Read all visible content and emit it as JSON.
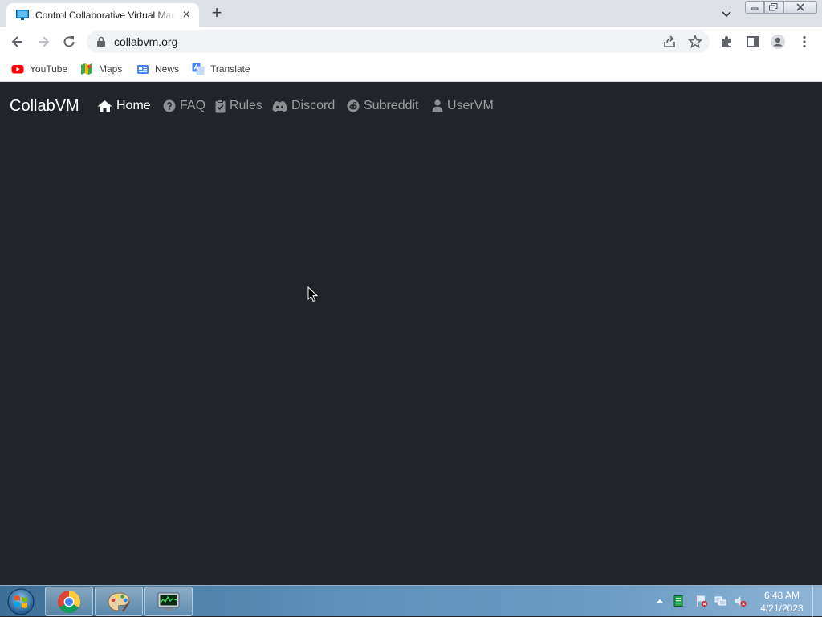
{
  "browser": {
    "tab": {
      "title": "Control Collaborative Virtual Machines!"
    },
    "address": {
      "url": "collabvm.org"
    },
    "bookmarks": [
      {
        "label": "YouTube",
        "icon": "youtube-icon"
      },
      {
        "label": "Maps",
        "icon": "maps-icon"
      },
      {
        "label": "News",
        "icon": "news-icon"
      },
      {
        "label": "Translate",
        "icon": "translate-icon"
      }
    ]
  },
  "site": {
    "brand": "CollabVM",
    "nav": [
      {
        "label": "Home",
        "icon": "home-icon",
        "active": true
      },
      {
        "label": "FAQ",
        "icon": "question-circle-icon"
      },
      {
        "label": "Rules",
        "icon": "clipboard-check-icon"
      },
      {
        "label": "Discord",
        "icon": "discord-icon"
      },
      {
        "label": "Subreddit",
        "icon": "reddit-icon"
      },
      {
        "label": "UserVM",
        "icon": "user-icon"
      }
    ]
  },
  "taskbar": {
    "clock": {
      "time": "6:48 AM",
      "date": "4/21/2023"
    }
  },
  "colors": {
    "page_bg": "#212529",
    "nav_active": "#ffffff",
    "nav_inactive": "#8c8e91"
  }
}
